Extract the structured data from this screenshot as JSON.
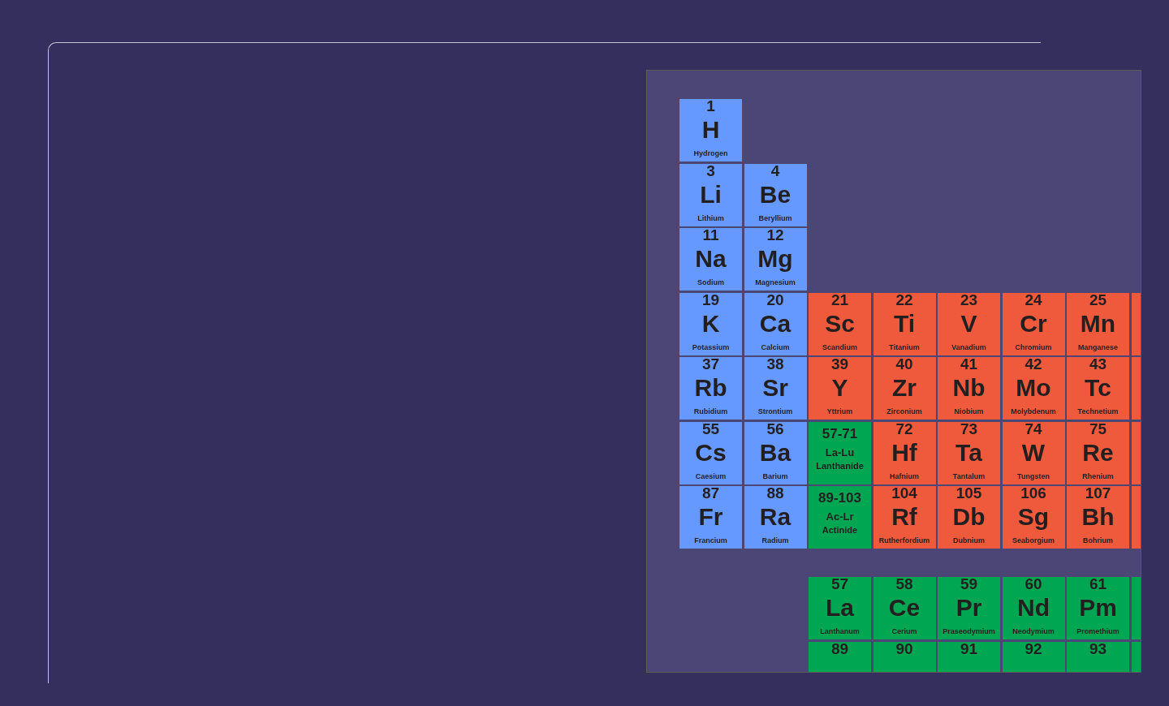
{
  "periodic_table": {
    "rows": [
      [
        {
          "kind": "element",
          "number": "1",
          "symbol": "H",
          "name": "Hydrogen",
          "color": "#6699ff"
        }
      ],
      [
        {
          "kind": "element",
          "number": "3",
          "symbol": "Li",
          "name": "Lithium",
          "color": "#6699ff"
        },
        {
          "kind": "element",
          "number": "4",
          "symbol": "Be",
          "name": "Beryllium",
          "color": "#6699ff"
        }
      ],
      [
        {
          "kind": "element",
          "number": "11",
          "symbol": "Na",
          "name": "Sodium",
          "color": "#6699ff"
        },
        {
          "kind": "element",
          "number": "12",
          "symbol": "Mg",
          "name": "Magnesium",
          "color": "#6699ff"
        }
      ],
      [
        {
          "kind": "element",
          "number": "19",
          "symbol": "K",
          "name": "Potassium",
          "color": "#6699ff"
        },
        {
          "kind": "element",
          "number": "20",
          "symbol": "Ca",
          "name": "Calcium",
          "color": "#6699ff"
        },
        {
          "kind": "element",
          "number": "21",
          "symbol": "Sc",
          "name": "Scandium",
          "color": "#f05a3c"
        },
        {
          "kind": "element",
          "number": "22",
          "symbol": "Ti",
          "name": "Titanium",
          "color": "#f05a3c"
        },
        {
          "kind": "element",
          "number": "23",
          "symbol": "V",
          "name": "Vanadium",
          "color": "#f05a3c"
        },
        {
          "kind": "element",
          "number": "24",
          "symbol": "Cr",
          "name": "Chromium",
          "color": "#f05a3c"
        },
        {
          "kind": "element",
          "number": "25",
          "symbol": "Mn",
          "name": "Manganese",
          "color": "#f05a3c"
        },
        {
          "kind": "partial",
          "color": "#f05a3c"
        }
      ],
      [
        {
          "kind": "element",
          "number": "37",
          "symbol": "Rb",
          "name": "Rubidium",
          "color": "#6699ff"
        },
        {
          "kind": "element",
          "number": "38",
          "symbol": "Sr",
          "name": "Strontium",
          "color": "#6699ff"
        },
        {
          "kind": "element",
          "number": "39",
          "symbol": "Y",
          "name": "Yttrium",
          "color": "#f05a3c"
        },
        {
          "kind": "element",
          "number": "40",
          "symbol": "Zr",
          "name": "Zirconium",
          "color": "#f05a3c"
        },
        {
          "kind": "element",
          "number": "41",
          "symbol": "Nb",
          "name": "Niobium",
          "color": "#f05a3c"
        },
        {
          "kind": "element",
          "number": "42",
          "symbol": "Mo",
          "name": "Molybdenum",
          "color": "#f05a3c"
        },
        {
          "kind": "element",
          "number": "43",
          "symbol": "Tc",
          "name": "Technetium",
          "color": "#f05a3c"
        },
        {
          "kind": "partial",
          "color": "#f05a3c"
        }
      ],
      [
        {
          "kind": "element",
          "number": "55",
          "symbol": "Cs",
          "name": "Caesium",
          "color": "#6699ff"
        },
        {
          "kind": "element",
          "number": "56",
          "symbol": "Ba",
          "name": "Barium",
          "color": "#6699ff"
        },
        {
          "kind": "range",
          "number": "57-71",
          "symbol": "La-Lu",
          "name": "Lanthanide",
          "color": "#00a651"
        },
        {
          "kind": "element",
          "number": "72",
          "symbol": "Hf",
          "name": "Hafnium",
          "color": "#f05a3c"
        },
        {
          "kind": "element",
          "number": "73",
          "symbol": "Ta",
          "name": "Tantalum",
          "color": "#f05a3c"
        },
        {
          "kind": "element",
          "number": "74",
          "symbol": "W",
          "name": "Tungsten",
          "color": "#f05a3c"
        },
        {
          "kind": "element",
          "number": "75",
          "symbol": "Re",
          "name": "Rhenium",
          "color": "#f05a3c"
        },
        {
          "kind": "partial",
          "color": "#f05a3c"
        }
      ],
      [
        {
          "kind": "element",
          "number": "87",
          "symbol": "Fr",
          "name": "Francium",
          "color": "#6699ff"
        },
        {
          "kind": "element",
          "number": "88",
          "symbol": "Ra",
          "name": "Radium",
          "color": "#6699ff"
        },
        {
          "kind": "range",
          "number": "89-103",
          "symbol": "Ac-Lr",
          "name": "Actinide",
          "color": "#00a651"
        },
        {
          "kind": "element",
          "number": "104",
          "symbol": "Rf",
          "name": "Rutherfordium",
          "color": "#f05a3c"
        },
        {
          "kind": "element",
          "number": "105",
          "symbol": "Db",
          "name": "Dubnium",
          "color": "#f05a3c"
        },
        {
          "kind": "element",
          "number": "106",
          "symbol": "Sg",
          "name": "Seaborgium",
          "color": "#f05a3c"
        },
        {
          "kind": "element",
          "number": "107",
          "symbol": "Bh",
          "name": "Bohrium",
          "color": "#f05a3c"
        },
        {
          "kind": "partial",
          "color": "#f05a3c"
        }
      ]
    ],
    "f_block": [
      [
        {
          "kind": "element",
          "number": "57",
          "symbol": "La",
          "name": "Lanthanum",
          "color": "#00a651"
        },
        {
          "kind": "element",
          "number": "58",
          "symbol": "Ce",
          "name": "Cerium",
          "color": "#00a651"
        },
        {
          "kind": "element",
          "number": "59",
          "symbol": "Pr",
          "name": "Praseodymium",
          "color": "#00a651"
        },
        {
          "kind": "element",
          "number": "60",
          "symbol": "Nd",
          "name": "Neodymium",
          "color": "#00a651"
        },
        {
          "kind": "element",
          "number": "61",
          "symbol": "Pm",
          "name": "Promethium",
          "color": "#00a651"
        },
        {
          "kind": "partial",
          "color": "#00a651"
        }
      ],
      [
        {
          "kind": "element",
          "number": "89",
          "color": "#00a651"
        },
        {
          "kind": "element",
          "number": "90",
          "color": "#00a651"
        },
        {
          "kind": "element",
          "number": "91",
          "color": "#00a651"
        },
        {
          "kind": "element",
          "number": "92",
          "color": "#00a651"
        },
        {
          "kind": "element",
          "number": "93",
          "color": "#00a651"
        },
        {
          "kind": "partial",
          "color": "#00a651"
        }
      ]
    ]
  }
}
